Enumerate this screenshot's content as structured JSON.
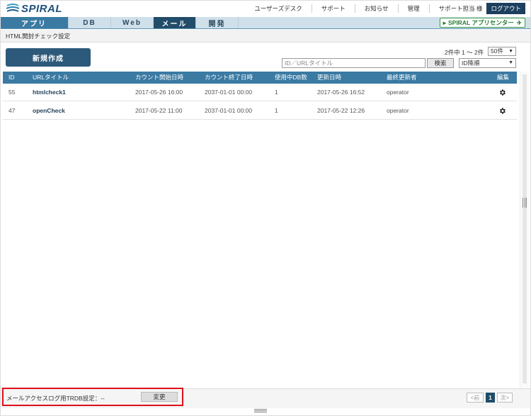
{
  "header": {
    "logo_text": "SPIRAL",
    "links": [
      "ユーザーズデスク",
      "サポート",
      "お知らせ",
      "管理"
    ],
    "user": "サポート担当 様",
    "logout": "ログアウト"
  },
  "nav": {
    "tabs": [
      {
        "label": "アプリ"
      },
      {
        "label": "DB"
      },
      {
        "label": "Web"
      },
      {
        "label": "メール"
      },
      {
        "label": "開発"
      }
    ],
    "app_center": "SPIRAL アプリセンター"
  },
  "breadcrumb": "HTML開封チェック設定",
  "toolbar": {
    "new_button": "新規作成",
    "count_text": "2件中 1 ～ 2件",
    "per_page": "50件",
    "search_placeholder": "ID／URLタイトル",
    "search_button": "検索",
    "sort": "ID降順"
  },
  "table": {
    "headers": [
      "ID",
      "URLタイトル",
      "カウント開始日時",
      "カウント終了日時",
      "使用中DB数",
      "更新日時",
      "最終更新者",
      "編集"
    ],
    "rows": [
      {
        "id": "55",
        "title": "htmlcheck1",
        "start": "2017-05-26 16:00",
        "end": "2037-01-01 00:00",
        "db_count": "1",
        "updated": "2017-05-26 16:52",
        "updater": "operator"
      },
      {
        "id": "47",
        "title": "openCheck",
        "start": "2017-05-22 11:00",
        "end": "2037-01-01 00:00",
        "db_count": "1",
        "updated": "2017-05-22 12:26",
        "updater": "operator"
      }
    ]
  },
  "footer": {
    "log_label": "メールアクセスログ用TRDB設定：--",
    "change_button": "変更",
    "prev": "<前",
    "current_page": "1",
    "next": "次>"
  },
  "colors": {
    "accent": "#3a7aa3",
    "dark": "#214c6a",
    "highlight": "#e0101a"
  },
  "icons": [
    "spiral-logo-icon",
    "gear-icon",
    "chevron-down-icon",
    "rocket-icon"
  ]
}
